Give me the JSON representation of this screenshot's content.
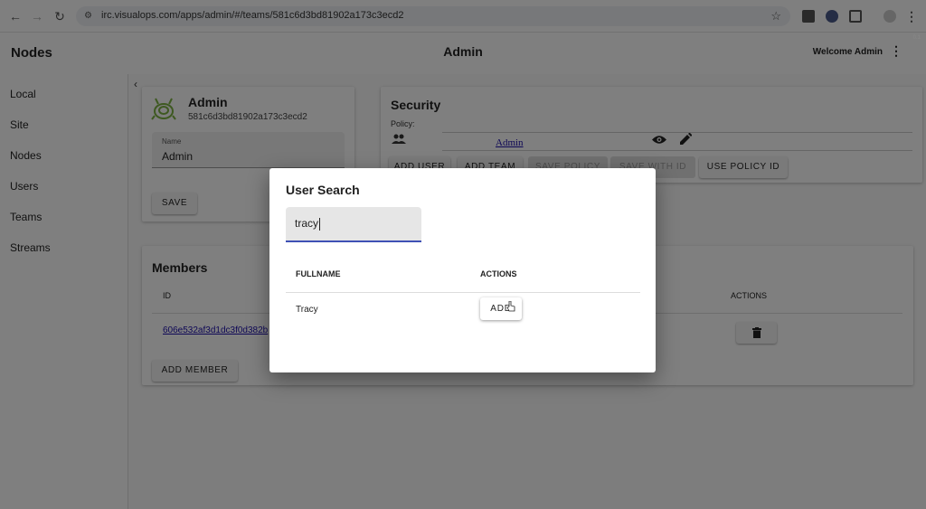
{
  "browser": {
    "url": "irc.visualops.com/apps/admin/#/teams/581c6d3bd81902a173c3ecd2",
    "version": "0.1"
  },
  "appbar": {
    "brand": "Nodes",
    "title": "Admin",
    "welcome": "Welcome Admin"
  },
  "sidebar": {
    "items": [
      {
        "label": "Local"
      },
      {
        "label": "Site"
      },
      {
        "label": "Nodes"
      },
      {
        "label": "Users"
      },
      {
        "label": "Teams"
      },
      {
        "label": "Streams"
      }
    ]
  },
  "team": {
    "name": "Admin",
    "id": "581c6d3bd81902a173c3ecd2",
    "name_label": "Name",
    "name_value": "Admin",
    "save_label": "SAVE"
  },
  "security": {
    "title": "Security",
    "policy_label": "Policy:",
    "policy_link": "Admin",
    "buttons": {
      "add_user": "ADD USER",
      "add_team": "ADD TEAM",
      "save_policy": "SAVE POLICY",
      "save_with_id": "SAVE WITH ID",
      "use_policy_id": "USE POLICY ID"
    }
  },
  "members": {
    "title": "Members",
    "col_id": "ID",
    "col_actions": "ACTIONS",
    "rows": [
      {
        "id": "606e532af3d1dc3f0d382b"
      }
    ],
    "add_member_label": "ADD MEMBER"
  },
  "dialog": {
    "title": "User Search",
    "search_value": "tracy",
    "col_fullname": "FULLNAME",
    "col_actions": "ACTIONS",
    "results": [
      {
        "fullname": "Tracy",
        "action": "ADD"
      }
    ]
  },
  "colors": {
    "accent": "#3f51b5",
    "link": "#1a0dab",
    "team_icon": "#7cb342"
  },
  "icons": {
    "back": "back-arrow-icon",
    "forward": "forward-arrow-icon",
    "reload": "reload-icon",
    "bookmark": "star-icon",
    "policy_type": "people-icon",
    "view": "eye-icon",
    "edit": "pencil-icon",
    "delete": "trash-icon",
    "team": "team-logo-icon"
  }
}
